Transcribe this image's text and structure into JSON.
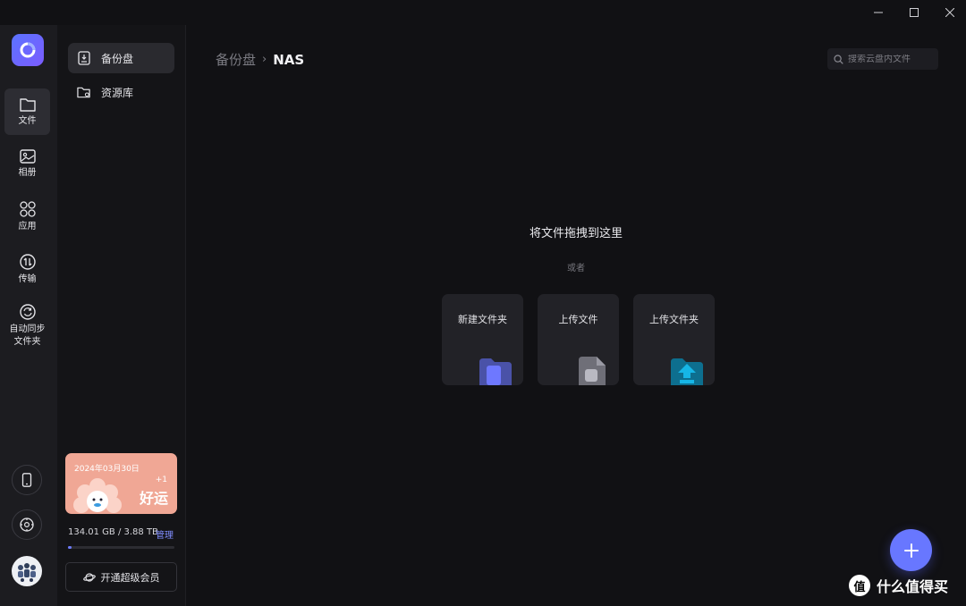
{
  "window": {
    "minimize_glyph": "—",
    "maximize_glyph": "☐",
    "close_glyph": "✕"
  },
  "rail": {
    "items": [
      {
        "label": "文件",
        "icon": "folder-icon",
        "active": true
      },
      {
        "label": "相册",
        "icon": "photo-icon"
      },
      {
        "label": "应用",
        "icon": "apps-icon"
      },
      {
        "label": "传输",
        "icon": "transfer-icon"
      },
      {
        "label": "自动同步\n文件夹",
        "icon": "sync-icon"
      }
    ],
    "bottom_icons": [
      "phone-icon",
      "settings-icon",
      "avatar"
    ]
  },
  "sidebar": {
    "items": [
      {
        "label": "备份盘",
        "icon": "backup-disk-icon",
        "active": true
      },
      {
        "label": "资源库",
        "icon": "resource-library-icon"
      }
    ],
    "promo": {
      "date": "2024年03月30日",
      "plus": "+1",
      "luck": "好运"
    },
    "storage": {
      "used_text": "134.01 GB / 3.88 TB",
      "manage_label": "管理",
      "fraction_used": 0.034
    },
    "vip_label": "开通超级会员"
  },
  "main": {
    "breadcrumb": {
      "root": "备份盘",
      "separator": "›",
      "current": "NAS"
    },
    "search": {
      "placeholder": "搜索云盘内文件"
    },
    "drop_title": "将文件拖拽到这里",
    "or_label": "或者",
    "cards": [
      {
        "label": "新建文件夹",
        "icon": "new-folder-icon",
        "color": "#6e78ff"
      },
      {
        "label": "上传文件",
        "icon": "upload-file-icon",
        "color": "#9a9aa4"
      },
      {
        "label": "上传文件夹",
        "icon": "upload-folder-icon",
        "color": "#16b6e6"
      }
    ],
    "fab_glyph": "+"
  },
  "watermark": {
    "glyph": "值",
    "text": "什么值得买"
  },
  "colors": {
    "accent": "#6877ff",
    "promo": "#f0a795",
    "background": "#111114"
  }
}
